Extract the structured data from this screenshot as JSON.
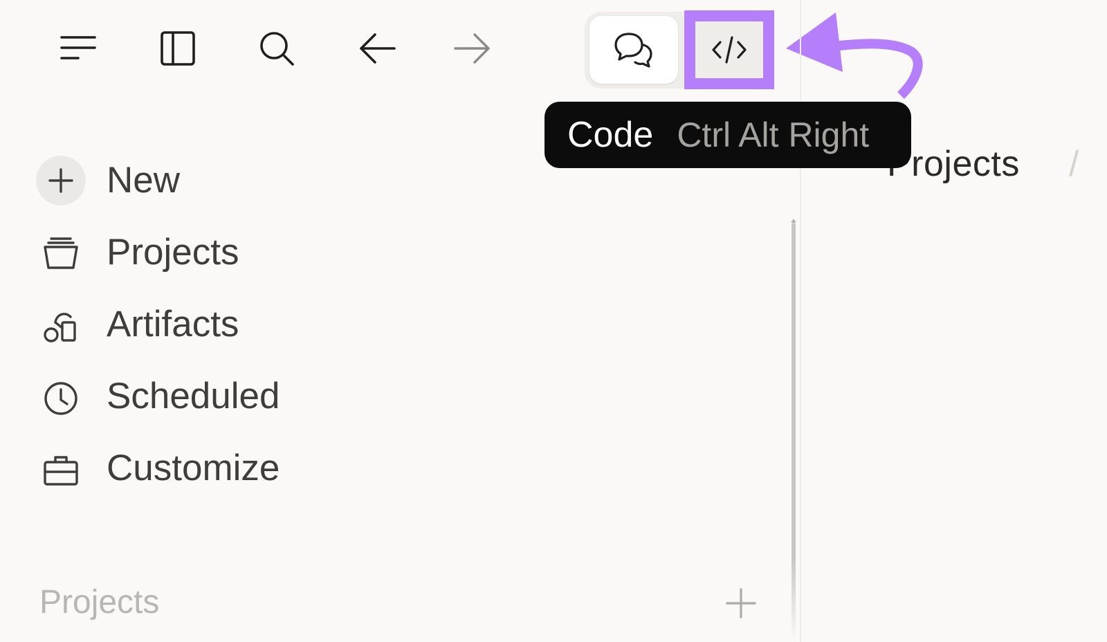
{
  "toolbar": {
    "icons": [
      "menu-icon",
      "sidebar-panel-icon",
      "search-icon",
      "arrow-left-icon",
      "arrow-right-icon"
    ]
  },
  "mode_switcher": {
    "chat_icon": "chat-bubbles-icon",
    "code_icon": "code-brackets-icon",
    "highlight_color": "#b57ffb"
  },
  "tooltip": {
    "label": "Code",
    "shortcut": "Ctrl Alt Right"
  },
  "breadcrumb": {
    "current": "Projects",
    "separator": "/"
  },
  "nav": {
    "items": [
      {
        "label": "New",
        "icon": "plus-icon"
      },
      {
        "label": "Projects",
        "icon": "folder-stack-icon"
      },
      {
        "label": "Artifacts",
        "icon": "shapes-icon"
      },
      {
        "label": "Scheduled",
        "icon": "clock-icon"
      },
      {
        "label": "Customize",
        "icon": "briefcase-icon"
      }
    ]
  },
  "projects_section": {
    "header": "Projects",
    "add_icon": "plus-icon"
  },
  "colors": {
    "background": "#faf9f7",
    "accent_annotation": "#b57ffb",
    "tooltip_bg": "#0c0c0c",
    "text_primary": "#3d3d3a",
    "text_muted": "#b8b6b2"
  }
}
